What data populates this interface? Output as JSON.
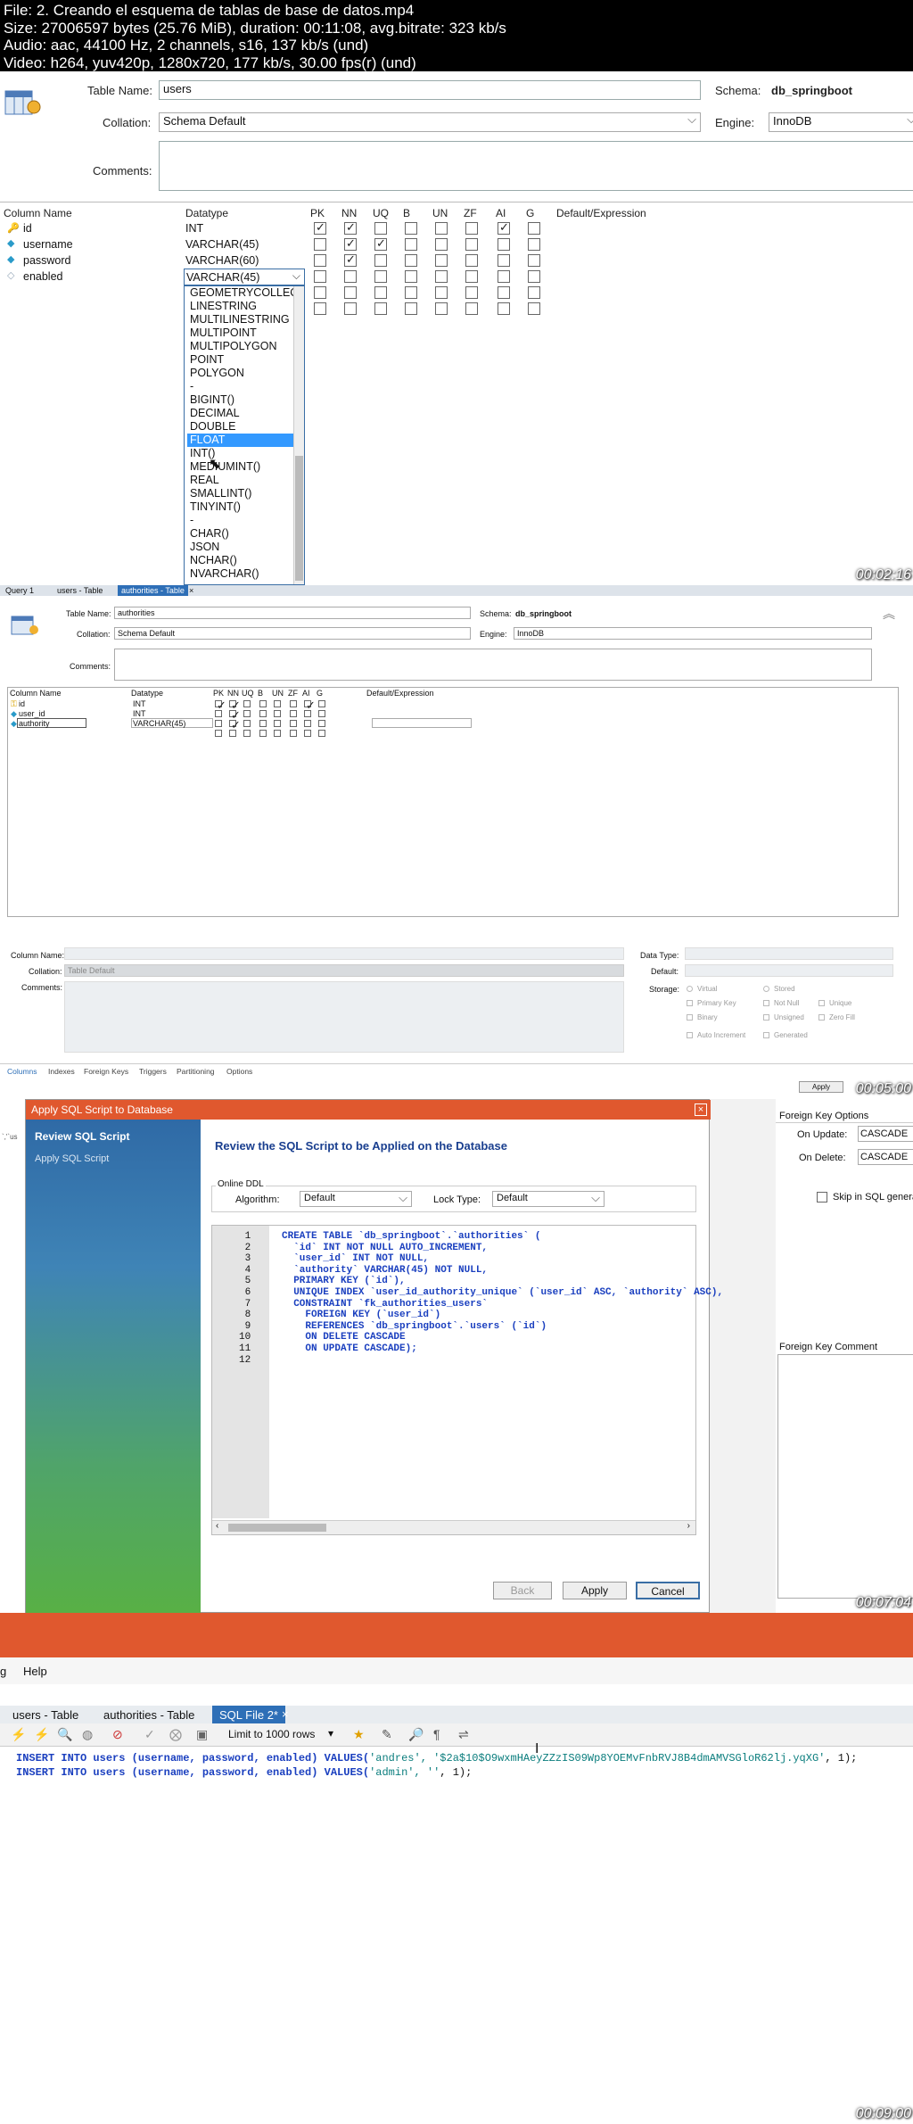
{
  "header": {
    "line1": "File: 2. Creando el esquema de tablas de base de datos.mp4",
    "line2": "Size: 27006597 bytes (25.76 MiB), duration: 00:11:08, avg.bitrate: 323 kb/s",
    "line3": "Audio: aac, 44100 Hz, 2 channels, s16, 137 kb/s (und)",
    "line4": "Video: h264, yuv420p, 1280x720, 177 kb/s, 30.00 fps(r) (und)"
  },
  "frame1": {
    "timestamp": "00:02:16",
    "table_name_label": "Table Name:",
    "table_name": "users",
    "schema_label": "Schema:",
    "schema": "db_springboot",
    "collation_label": "Collation:",
    "collation": "Schema Default",
    "engine_label": "Engine:",
    "engine": "InnoDB",
    "comments_label": "Comments:",
    "grid_headers": [
      "Column Name",
      "Datatype",
      "PK",
      "NN",
      "UQ",
      "B",
      "UN",
      "ZF",
      "AI",
      "G",
      "Default/Expression"
    ],
    "rows": [
      {
        "name": "id",
        "type": "INT"
      },
      {
        "name": "username",
        "type": "VARCHAR(45)"
      },
      {
        "name": "password",
        "type": "VARCHAR(60)"
      },
      {
        "name": "enabled",
        "type": "VARCHAR(45)"
      }
    ],
    "dropdown_items": [
      "GEOMETRYCOLLEC",
      "LINESTRING",
      "MULTILINESTRING",
      "MULTIPOINT",
      "MULTIPOLYGON",
      "POINT",
      "POLYGON",
      "-",
      "BIGINT()",
      "DECIMAL",
      "DOUBLE",
      "FLOAT",
      "INT()",
      "MEDIUMINT()",
      "REAL",
      "SMALLINT()",
      "TINYINT()",
      "-",
      "CHAR()",
      "JSON",
      "NCHAR()",
      "NVARCHAR()"
    ],
    "dropdown_selected": "FLOAT"
  },
  "frame2": {
    "timestamp": "00:05:00",
    "tabs": [
      "Query 1",
      "users - Table",
      "authorities - Table"
    ],
    "table_name_label": "Table Name:",
    "table_name": "authorities",
    "schema_label": "Schema:",
    "schema": "db_springboot",
    "collation_label": "Collation:",
    "collation": "Schema Default",
    "engine_label": "Engine:",
    "engine": "InnoDB",
    "comments_label": "Comments:",
    "grid_headers": [
      "Column Name",
      "Datatype",
      "PK",
      "NN",
      "UQ",
      "B",
      "UN",
      "ZF",
      "AI",
      "G",
      "Default/Expression"
    ],
    "rows": [
      {
        "name": "id",
        "type": "INT"
      },
      {
        "name": "user_id",
        "type": "INT"
      },
      {
        "name": "authority",
        "type": "VARCHAR(45)"
      }
    ],
    "detail": {
      "column_name_label": "Column Name:",
      "collation_label": "Collation:",
      "collation": "Table Default",
      "comments_label": "Comments:",
      "data_type_label": "Data Type:",
      "default_label": "Default:",
      "storage_label": "Storage:",
      "opts": [
        "Virtual",
        "Stored",
        "Primary Key",
        "Not Null",
        "Unique",
        "Binary",
        "Unsigned",
        "Zero Fill",
        "Auto Increment",
        "Generated"
      ]
    },
    "bottom_tabs": [
      "Columns",
      "Indexes",
      "Foreign Keys",
      "Triggers",
      "Partitioning",
      "Options"
    ],
    "apply": "Apply"
  },
  "frame3": {
    "timestamp": "00:07:04",
    "dialog_title": "Apply SQL Script to Database",
    "steps": [
      "Review SQL Script",
      "Apply SQL Script"
    ],
    "heading": "Review the SQL Script to be Applied on the Database",
    "online_ddl": "Online DDL",
    "algorithm_label": "Algorithm:",
    "algorithm": "Default",
    "lock_label": "Lock Type:",
    "lock": "Default",
    "code_lines": [
      "CREATE TABLE `db_springboot`.`authorities` (",
      "  `id` INT NOT NULL AUTO_INCREMENT,",
      "  `user_id` INT NOT NULL,",
      "  `authority` VARCHAR(45) NOT NULL,",
      "  PRIMARY KEY (`id`),",
      "  UNIQUE INDEX `user_id_authority_unique` (`user_id` ASC, `authority` ASC),",
      "  CONSTRAINT `fk_authorities_users`",
      "    FOREIGN KEY (`user_id`)",
      "    REFERENCES `db_springboot`.`users` (`id`)",
      "    ON DELETE CASCADE",
      "    ON UPDATE CASCADE);",
      ""
    ],
    "buttons": [
      "Back",
      "Apply",
      "Cancel"
    ],
    "fk_options": "Foreign Key Options",
    "on_update_label": "On Update:",
    "on_update": "CASCADE",
    "on_delete_label": "On Delete:",
    "on_delete": "CASCADE",
    "skip_label": "Skip in SQL genera",
    "fk_comment": "Foreign Key Comment"
  },
  "frame4": {
    "timestamp": "00:09:00",
    "menu": [
      "g",
      "Help"
    ],
    "tabs": [
      "users - Table",
      "authorities - Table",
      "SQL File 2*"
    ],
    "limit": "Limit to 1000 rows",
    "line1a": "INSERT INTO users (username, password, enabled) VALUES(",
    "line1b": "'andres', '$2a$10$O9wxmHAeyZZzIS09Wp8YOEMvFnbRVJ8B4dmAMVSGloR62lj.yqXG'",
    "line1c": ", 1);",
    "line2a": "INSERT INTO users (username, password, enabled) VALUES(",
    "line2b": "'admin', ''",
    "line2c": ", 1);"
  }
}
